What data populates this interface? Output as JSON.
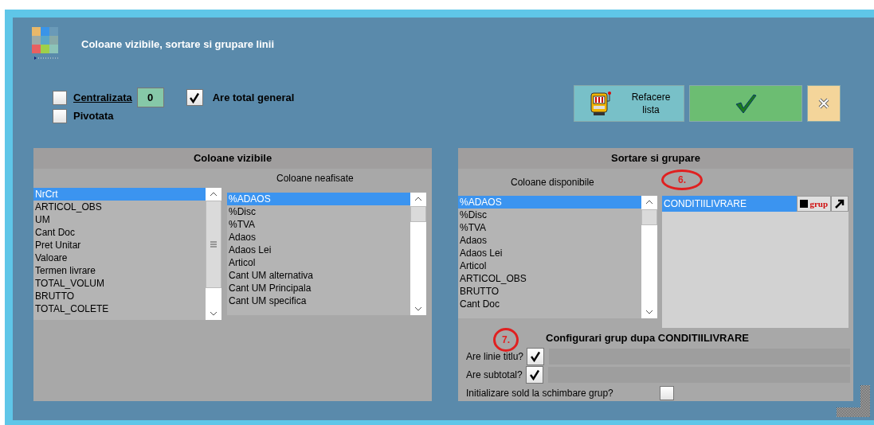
{
  "window": {
    "title": "Coloane vizibile, sortare si grupare linii"
  },
  "options": [
    {
      "label": "Centralizata",
      "checked": false,
      "value": "0"
    },
    {
      "label": "Pivotata",
      "checked": false
    },
    {
      "label": "Are total general",
      "checked": true
    }
  ],
  "buttons": [
    {
      "kind": "refresh",
      "label": "Refacere lista"
    },
    {
      "kind": "ok"
    },
    {
      "kind": "cancel"
    }
  ],
  "visible_columns": {
    "title": "Coloane vizibile",
    "hidden_label": "Coloane neafisate",
    "shown": [
      {
        "label": "NrCrt",
        "selected": true
      },
      {
        "label": "ARTICOL_OBS",
        "selected": false
      },
      {
        "label": "UM",
        "selected": false
      },
      {
        "label": "Cant Doc",
        "selected": false
      },
      {
        "label": "Pret Unitar",
        "selected": false
      },
      {
        "label": "Valoare",
        "selected": false
      },
      {
        "label": "Termen livrare",
        "selected": false
      },
      {
        "label": "TOTAL_VOLUM",
        "selected": false
      },
      {
        "label": "BRUTTO",
        "selected": false
      },
      {
        "label": "TOTAL_COLETE",
        "selected": false
      }
    ],
    "hidden": [
      {
        "label": "%ADAOS",
        "selected": true
      },
      {
        "label": "%Disc",
        "selected": false
      },
      {
        "label": "%TVA",
        "selected": false
      },
      {
        "label": "Adaos",
        "selected": false
      },
      {
        "label": "Adaos Lei",
        "selected": false
      },
      {
        "label": "Articol",
        "selected": false
      },
      {
        "label": "Cant UM alternativa",
        "selected": false
      },
      {
        "label": "Cant UM Principala",
        "selected": false
      },
      {
        "label": "Cant UM specifica",
        "selected": false
      }
    ]
  },
  "sorting": {
    "title": "Sortare si grupare",
    "available_label": "Coloane disponibile",
    "annotation": "6.",
    "available": [
      {
        "label": "%ADAOS",
        "selected": true
      },
      {
        "label": "%Disc",
        "selected": false
      },
      {
        "label": "%TVA",
        "selected": false
      },
      {
        "label": "Adaos",
        "selected": false
      },
      {
        "label": "Adaos Lei",
        "selected": false
      },
      {
        "label": "Articol",
        "selected": false
      },
      {
        "label": "ARTICOL_OBS",
        "selected": false
      },
      {
        "label": "BRUTTO",
        "selected": false
      },
      {
        "label": "Cant Doc",
        "selected": false
      }
    ],
    "sorted": [
      {
        "label": "CONDITIILIVRARE",
        "selected": true,
        "tag": "grup"
      }
    ]
  },
  "group_config": {
    "title": "Configurari grup dupa CONDITIILIVRARE",
    "annotation": "7.",
    "rows": [
      {
        "label": "Are linie titlu?",
        "checked": true,
        "kind": "field"
      },
      {
        "label": "Are subtotal?",
        "checked": true,
        "kind": "field"
      },
      {
        "label": "Initializare sold la schimbare grup?",
        "checked": false,
        "kind": "plain"
      }
    ]
  }
}
